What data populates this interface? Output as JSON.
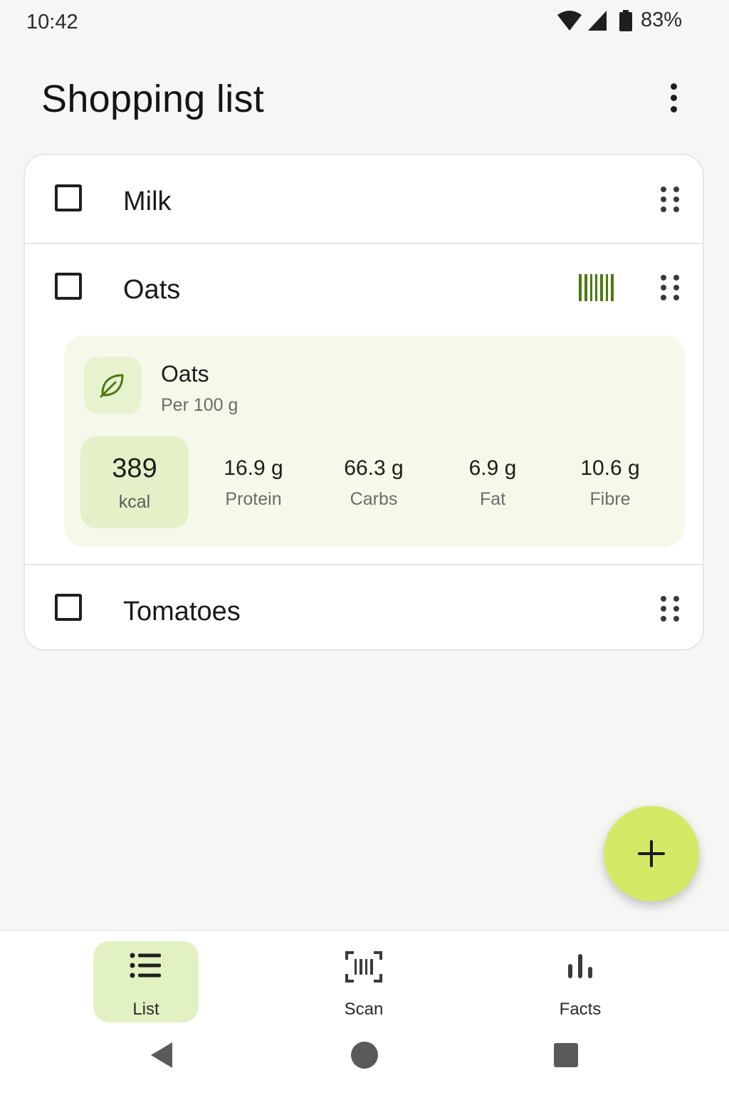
{
  "status": {
    "time": "10:42",
    "battery": "83%"
  },
  "appbar": {
    "title": "Shopping list"
  },
  "items": [
    {
      "label": "Milk"
    },
    {
      "label": "Oats"
    },
    {
      "label": "Tomatoes"
    }
  ],
  "nutrition": {
    "name": "Oats",
    "per": "Per 100 g",
    "kcal": "389",
    "kcal_unit": "kcal",
    "macros": [
      {
        "value": "16.9 g",
        "label": "Protein"
      },
      {
        "value": "66.3 g",
        "label": "Carbs"
      },
      {
        "value": "6.9 g",
        "label": "Fat"
      },
      {
        "value": "10.6 g",
        "label": "Fibre"
      }
    ]
  },
  "nav": {
    "items": [
      {
        "label": "List",
        "icon": "list-icon",
        "active": true
      },
      {
        "label": "Scan",
        "icon": "scan-icon",
        "active": false
      },
      {
        "label": "Facts",
        "icon": "bar-chart-icon",
        "active": false
      }
    ]
  },
  "colors": {
    "accent": "#d4ea66",
    "barcode": "#4a7a0f",
    "nutri_bg": "#f4f9ea"
  }
}
